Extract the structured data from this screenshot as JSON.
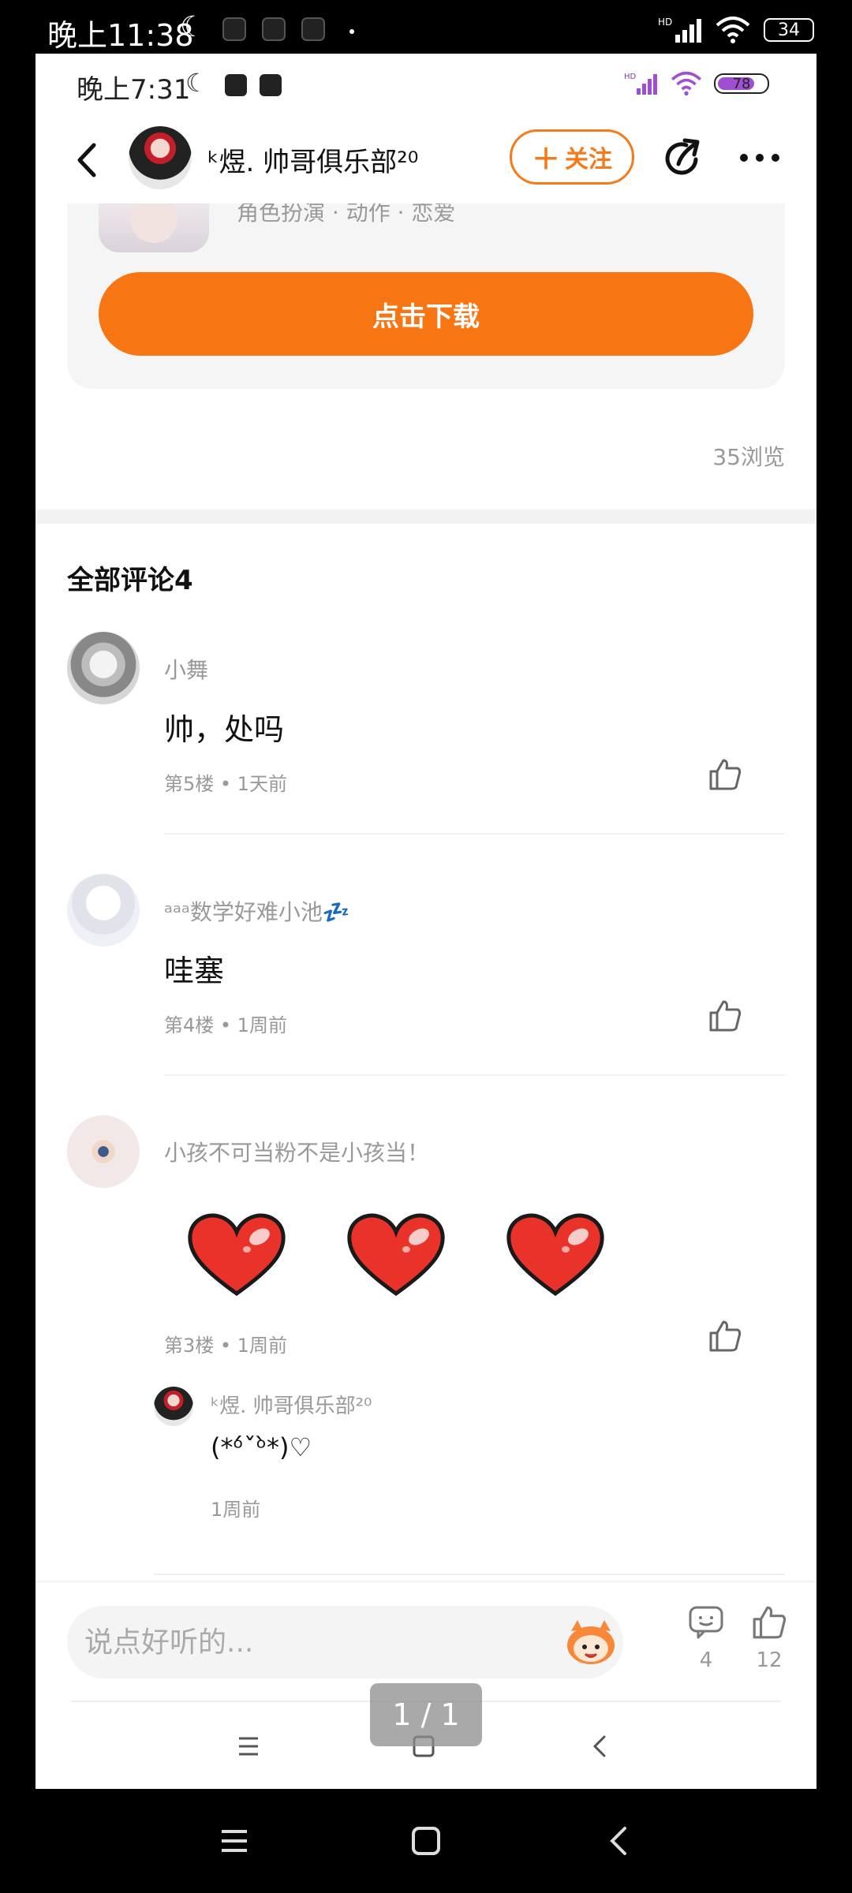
{
  "outer_status": {
    "time": "晚上11:38",
    "battery": "34",
    "signal_label": "HD"
  },
  "inner_status": {
    "time": "晚上7:31",
    "battery": "78",
    "signal_label": "HD"
  },
  "header": {
    "title": "ᵏ煜. 帅哥俱乐部²⁰",
    "follow_label": "关注"
  },
  "app_card": {
    "tags": "角色扮演 · 动作 · 恋爱",
    "download_label": "点击下载"
  },
  "views": "35浏览",
  "comments_title": "全部评论4",
  "comments": [
    {
      "name": "小舞",
      "text": "帅，处吗",
      "meta": "第5楼 • 1天前"
    },
    {
      "name": "ᵃᵃᵃ数学好难小池💤",
      "text": "哇塞",
      "meta": "第4楼 • 1周前"
    },
    {
      "name": "小孩不可当粉不是小孩当！",
      "text": "",
      "meta": "第3楼 • 1周前"
    }
  ],
  "reply": {
    "name": "ᵏ煜. 帅哥俱乐部²⁰",
    "text": "(*ᵒ́ˇᵒ̀*)♡",
    "time": "1周前"
  },
  "bottom_bar": {
    "input_placeholder": "说点好听的...",
    "comment_count": "4",
    "like_count": "12"
  },
  "page_indicator": "1 / 1",
  "colors": {
    "accent": "#f87513",
    "muted_text": "#999999"
  }
}
